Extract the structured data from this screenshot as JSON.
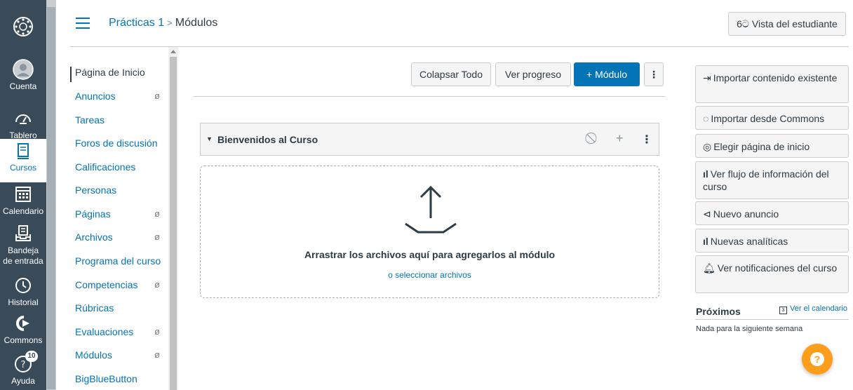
{
  "global_nav": {
    "items": [
      {
        "label": "Cuenta",
        "icon": "account-icon"
      },
      {
        "label": "Tablero",
        "icon": "dashboard-icon"
      },
      {
        "label": "Cursos",
        "icon": "courses-icon"
      },
      {
        "label": "Calendario",
        "icon": "calendar-icon"
      },
      {
        "label": "Bandeja",
        "label2": "de entrada",
        "icon": "inbox-icon"
      },
      {
        "label": "Historial",
        "icon": "history-icon"
      },
      {
        "label": "Commons",
        "icon": "commons-icon"
      },
      {
        "label": "Ayuda",
        "icon": "help-icon",
        "badge": "10"
      }
    ]
  },
  "header": {
    "breadcrumb_course": "Prácticas 1",
    "breadcrumb_sep": ">",
    "breadcrumb_page": "Módulos",
    "student_view": "Vista del estudiante"
  },
  "course_nav": {
    "items": [
      {
        "label": "Página de Inicio",
        "active": true,
        "hidden": false
      },
      {
        "label": "Anuncios",
        "hidden": true
      },
      {
        "label": "Tareas",
        "hidden": false
      },
      {
        "label": "Foros de discusión",
        "hidden": false
      },
      {
        "label": "Calificaciones",
        "hidden": false
      },
      {
        "label": "Personas",
        "hidden": false
      },
      {
        "label": "Páginas",
        "hidden": true
      },
      {
        "label": "Archivos",
        "hidden": true
      },
      {
        "label": "Programa del curso",
        "hidden": false
      },
      {
        "label": "Competencias",
        "hidden": true
      },
      {
        "label": "Rúbricas",
        "hidden": false
      },
      {
        "label": "Evaluaciones",
        "hidden": true
      },
      {
        "label": "Módulos",
        "hidden": true
      },
      {
        "label": "BigBlueButton",
        "hidden": false
      }
    ]
  },
  "toolbar": {
    "collapse_all": "Colapsar Todo",
    "view_progress": "Ver progreso",
    "add_module": "+ Módulo"
  },
  "module": {
    "title": "Bienvenidos al Curso"
  },
  "dropzone": {
    "text": "Arrastrar los archivos aquí para agregarlos al módulo",
    "link": "o seleccionar archivos"
  },
  "sidebar": {
    "buttons": [
      {
        "label": "Importar contenido existente",
        "icon": "import-icon"
      },
      {
        "label": "Importar desde Commons",
        "icon": "commons-icon"
      },
      {
        "label": "Elegir página de inicio",
        "icon": "target-icon"
      },
      {
        "label": "Ver flujo de información del curso",
        "icon": "bar-chart-icon"
      },
      {
        "label": "Nuevo anuncio",
        "icon": "megaphone-icon"
      },
      {
        "label": "Nuevas analíticas",
        "icon": "bar-chart-icon"
      },
      {
        "label": "Ver notificaciones del curso",
        "icon": "bell-icon"
      }
    ],
    "upcoming_title": "Próximos",
    "calendar_link": "Ver el calendario",
    "calendar_day": "3",
    "nothing_text": "Nada para la siguiente semana"
  },
  "colors": {
    "nav_bg": "#394b58",
    "link": "#0374b5",
    "help": "#fc9d1c"
  }
}
